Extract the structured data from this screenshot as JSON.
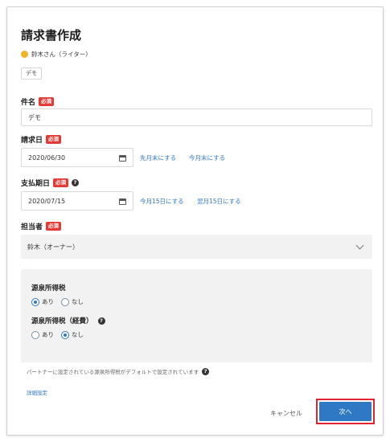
{
  "title": "請求書作成",
  "user": {
    "name": "鈴木さん（ライター）"
  },
  "tag": "デモ",
  "subject": {
    "label": "件名",
    "required": "必須",
    "value": "デモ"
  },
  "invoice_date": {
    "label": "請求日",
    "required": "必須",
    "value": "2020/06/30",
    "links": [
      "先月末にする",
      "今月末にする"
    ]
  },
  "payment_date": {
    "label": "支払期日",
    "required": "必須",
    "value": "2020/07/15",
    "links": [
      "今月15日にする",
      "翌月15日にする"
    ]
  },
  "assignee": {
    "label": "担当者",
    "required": "必須",
    "value": "鈴木（オーナー）"
  },
  "withholding_tax": {
    "label": "源泉所得税",
    "options": [
      "あり",
      "なし"
    ],
    "selected": "あり"
  },
  "withholding_tax_expense": {
    "label": "源泉所得税（経費）",
    "options": [
      "あり",
      "なし"
    ],
    "selected": "なし"
  },
  "note": "パートナーに設定されている源泉所得税がデフォルトで設定されています",
  "detail_link": "詳細設定",
  "buttons": {
    "cancel": "キャンセル",
    "next": "次へ"
  },
  "colors": {
    "accent": "#2f78c4",
    "required": "#e53935",
    "highlight": "#e0232f"
  }
}
